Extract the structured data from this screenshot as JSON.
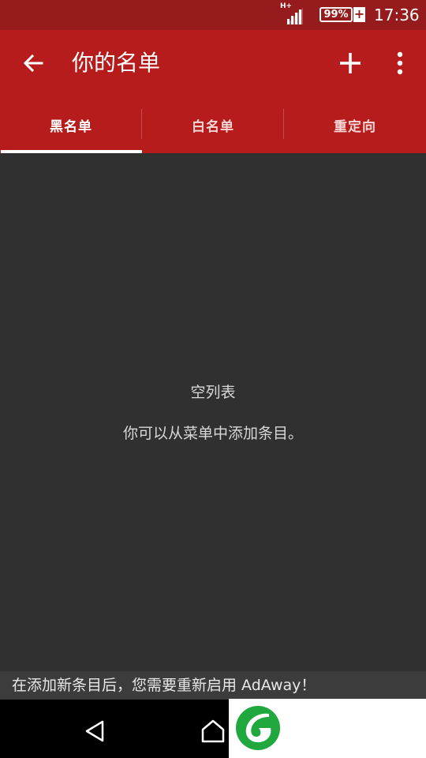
{
  "status_bar": {
    "network_label": "H+",
    "battery_level": "99%",
    "charging_indicator": "+",
    "time": "17:36",
    "icons": [
      "signal-icon",
      "battery-icon",
      "charging-icon"
    ]
  },
  "app_bar": {
    "title": "你的名单",
    "back_icon": "arrow-left-icon",
    "add_icon": "plus-icon",
    "more_icon": "more-vertical-icon",
    "background_color": "#b71c1c"
  },
  "tabs": [
    {
      "label": "黑名单",
      "selected": true
    },
    {
      "label": "白名单",
      "selected": false
    },
    {
      "label": "重定向",
      "selected": false
    }
  ],
  "empty_state": {
    "title": "空列表",
    "hint": "你可以从菜单中添加条目。"
  },
  "snackbar": {
    "message": "在添加新条目后，您需要重新启用 AdAway！"
  },
  "navigation_bar": {
    "icons": [
      "triangle-back-icon",
      "home-icon"
    ]
  },
  "colors": {
    "status_bar": "#951b1c",
    "accent": "#b71c1c",
    "content_background": "#303030",
    "watermark": "#20a83f"
  }
}
